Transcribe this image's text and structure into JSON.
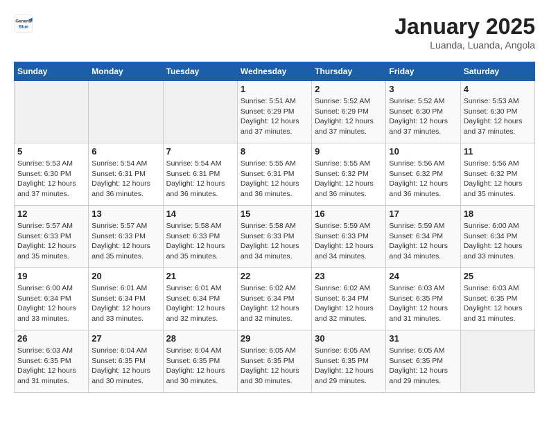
{
  "header": {
    "logo": {
      "general": "General",
      "blue": "Blue"
    },
    "title": "January 2025",
    "subtitle": "Luanda, Luanda, Angola"
  },
  "weekdays": [
    "Sunday",
    "Monday",
    "Tuesday",
    "Wednesday",
    "Thursday",
    "Friday",
    "Saturday"
  ],
  "weeks": [
    [
      {
        "day": null
      },
      {
        "day": null
      },
      {
        "day": null
      },
      {
        "day": 1,
        "sunrise": "5:51 AM",
        "sunset": "6:29 PM",
        "daylight": "12 hours and 37 minutes."
      },
      {
        "day": 2,
        "sunrise": "5:52 AM",
        "sunset": "6:29 PM",
        "daylight": "12 hours and 37 minutes."
      },
      {
        "day": 3,
        "sunrise": "5:52 AM",
        "sunset": "6:30 PM",
        "daylight": "12 hours and 37 minutes."
      },
      {
        "day": 4,
        "sunrise": "5:53 AM",
        "sunset": "6:30 PM",
        "daylight": "12 hours and 37 minutes."
      }
    ],
    [
      {
        "day": 5,
        "sunrise": "5:53 AM",
        "sunset": "6:30 PM",
        "daylight": "12 hours and 37 minutes."
      },
      {
        "day": 6,
        "sunrise": "5:54 AM",
        "sunset": "6:31 PM",
        "daylight": "12 hours and 36 minutes."
      },
      {
        "day": 7,
        "sunrise": "5:54 AM",
        "sunset": "6:31 PM",
        "daylight": "12 hours and 36 minutes."
      },
      {
        "day": 8,
        "sunrise": "5:55 AM",
        "sunset": "6:31 PM",
        "daylight": "12 hours and 36 minutes."
      },
      {
        "day": 9,
        "sunrise": "5:55 AM",
        "sunset": "6:32 PM",
        "daylight": "12 hours and 36 minutes."
      },
      {
        "day": 10,
        "sunrise": "5:56 AM",
        "sunset": "6:32 PM",
        "daylight": "12 hours and 36 minutes."
      },
      {
        "day": 11,
        "sunrise": "5:56 AM",
        "sunset": "6:32 PM",
        "daylight": "12 hours and 35 minutes."
      }
    ],
    [
      {
        "day": 12,
        "sunrise": "5:57 AM",
        "sunset": "6:33 PM",
        "daylight": "12 hours and 35 minutes."
      },
      {
        "day": 13,
        "sunrise": "5:57 AM",
        "sunset": "6:33 PM",
        "daylight": "12 hours and 35 minutes."
      },
      {
        "day": 14,
        "sunrise": "5:58 AM",
        "sunset": "6:33 PM",
        "daylight": "12 hours and 35 minutes."
      },
      {
        "day": 15,
        "sunrise": "5:58 AM",
        "sunset": "6:33 PM",
        "daylight": "12 hours and 34 minutes."
      },
      {
        "day": 16,
        "sunrise": "5:59 AM",
        "sunset": "6:33 PM",
        "daylight": "12 hours and 34 minutes."
      },
      {
        "day": 17,
        "sunrise": "5:59 AM",
        "sunset": "6:34 PM",
        "daylight": "12 hours and 34 minutes."
      },
      {
        "day": 18,
        "sunrise": "6:00 AM",
        "sunset": "6:34 PM",
        "daylight": "12 hours and 33 minutes."
      }
    ],
    [
      {
        "day": 19,
        "sunrise": "6:00 AM",
        "sunset": "6:34 PM",
        "daylight": "12 hours and 33 minutes."
      },
      {
        "day": 20,
        "sunrise": "6:01 AM",
        "sunset": "6:34 PM",
        "daylight": "12 hours and 33 minutes."
      },
      {
        "day": 21,
        "sunrise": "6:01 AM",
        "sunset": "6:34 PM",
        "daylight": "12 hours and 32 minutes."
      },
      {
        "day": 22,
        "sunrise": "6:02 AM",
        "sunset": "6:34 PM",
        "daylight": "12 hours and 32 minutes."
      },
      {
        "day": 23,
        "sunrise": "6:02 AM",
        "sunset": "6:34 PM",
        "daylight": "12 hours and 32 minutes."
      },
      {
        "day": 24,
        "sunrise": "6:03 AM",
        "sunset": "6:35 PM",
        "daylight": "12 hours and 31 minutes."
      },
      {
        "day": 25,
        "sunrise": "6:03 AM",
        "sunset": "6:35 PM",
        "daylight": "12 hours and 31 minutes."
      }
    ],
    [
      {
        "day": 26,
        "sunrise": "6:03 AM",
        "sunset": "6:35 PM",
        "daylight": "12 hours and 31 minutes."
      },
      {
        "day": 27,
        "sunrise": "6:04 AM",
        "sunset": "6:35 PM",
        "daylight": "12 hours and 30 minutes."
      },
      {
        "day": 28,
        "sunrise": "6:04 AM",
        "sunset": "6:35 PM",
        "daylight": "12 hours and 30 minutes."
      },
      {
        "day": 29,
        "sunrise": "6:05 AM",
        "sunset": "6:35 PM",
        "daylight": "12 hours and 30 minutes."
      },
      {
        "day": 30,
        "sunrise": "6:05 AM",
        "sunset": "6:35 PM",
        "daylight": "12 hours and 29 minutes."
      },
      {
        "day": 31,
        "sunrise": "6:05 AM",
        "sunset": "6:35 PM",
        "daylight": "12 hours and 29 minutes."
      },
      {
        "day": null
      }
    ]
  ]
}
